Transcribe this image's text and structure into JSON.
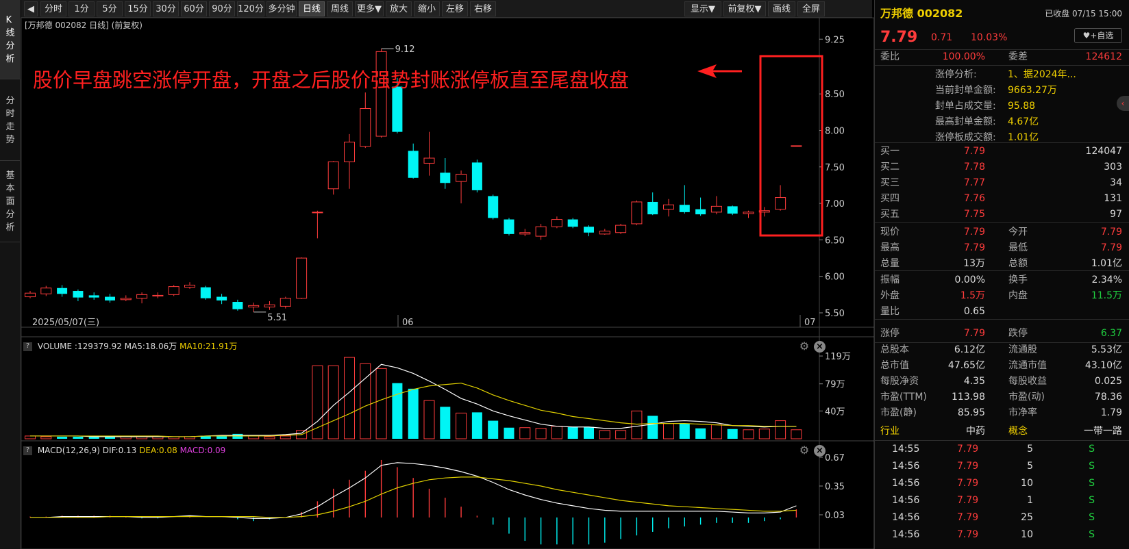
{
  "nav": [
    "K线分析",
    "分时走势",
    "基本面分析"
  ],
  "toolbar": {
    "items": [
      "分时",
      "1分",
      "5分",
      "15分",
      "30分",
      "60分",
      "90分",
      "120分",
      "多分钟",
      "日线",
      "周线",
      "更多▼",
      "放大",
      "缩小",
      "左移",
      "右移"
    ],
    "active": "日线",
    "right": [
      "显示▼",
      "前复权▼",
      "画线",
      "全屏"
    ]
  },
  "chart_title": "[万邦德 002082 日线] (前复权)",
  "annotation": "股价早盘跳空涨停开盘，开盘之后股价强势封账涨停板直至尾盘收盘",
  "kline": {
    "price_axis": [
      "9.25",
      "8.50",
      "8.00",
      "7.50",
      "7.00",
      "6.50",
      "6.00",
      "5.50"
    ],
    "high_label": "9.12",
    "low_label": "5.51",
    "date_labels": [
      "2025/05/07(三)",
      "06",
      "07"
    ],
    "candles": [
      {
        "o": 5.72,
        "c": 5.77,
        "h": 5.8,
        "l": 5.7
      },
      {
        "o": 5.76,
        "c": 5.84,
        "h": 5.87,
        "l": 5.73
      },
      {
        "o": 5.84,
        "c": 5.76,
        "h": 5.88,
        "l": 5.72
      },
      {
        "o": 5.8,
        "c": 5.71,
        "h": 5.82,
        "l": 5.66
      },
      {
        "o": 5.74,
        "c": 5.71,
        "h": 5.78,
        "l": 5.68
      },
      {
        "o": 5.72,
        "c": 5.67,
        "h": 5.76,
        "l": 5.64
      },
      {
        "o": 5.68,
        "c": 5.7,
        "h": 5.74,
        "l": 5.66
      },
      {
        "o": 5.7,
        "c": 5.75,
        "h": 5.78,
        "l": 5.63
      },
      {
        "o": 5.73,
        "c": 5.74,
        "h": 5.78,
        "l": 5.7
      },
      {
        "o": 5.75,
        "c": 5.86,
        "h": 5.88,
        "l": 5.73
      },
      {
        "o": 5.85,
        "c": 5.88,
        "h": 5.92,
        "l": 5.83
      },
      {
        "o": 5.85,
        "c": 5.7,
        "h": 5.87,
        "l": 5.68
      },
      {
        "o": 5.72,
        "c": 5.67,
        "h": 5.76,
        "l": 5.62
      },
      {
        "o": 5.65,
        "c": 5.55,
        "h": 5.68,
        "l": 5.53
      },
      {
        "o": 5.58,
        "c": 5.6,
        "h": 5.64,
        "l": 5.51
      },
      {
        "o": 5.58,
        "c": 5.61,
        "h": 5.66,
        "l": 5.54
      },
      {
        "o": 5.59,
        "c": 5.7,
        "h": 5.72,
        "l": 5.56
      },
      {
        "o": 5.7,
        "c": 6.25,
        "h": 6.26,
        "l": 5.69
      },
      {
        "o": 6.88,
        "c": 6.88,
        "h": 6.9,
        "l": 6.52
      },
      {
        "o": 7.2,
        "c": 7.57,
        "h": 7.58,
        "l": 7.12
      },
      {
        "o": 7.57,
        "c": 7.84,
        "h": 7.95,
        "l": 7.2
      },
      {
        "o": 7.78,
        "c": 8.3,
        "h": 8.52,
        "l": 7.76
      },
      {
        "o": 7.92,
        "c": 9.08,
        "h": 9.12,
        "l": 7.9
      },
      {
        "o": 8.6,
        "c": 7.98,
        "h": 8.72,
        "l": 7.96
      },
      {
        "o": 7.72,
        "c": 7.35,
        "h": 7.82,
        "l": 7.34
      },
      {
        "o": 7.55,
        "c": 7.62,
        "h": 7.98,
        "l": 7.38
      },
      {
        "o": 7.42,
        "c": 7.28,
        "h": 7.62,
        "l": 7.2
      },
      {
        "o": 7.3,
        "c": 7.4,
        "h": 7.45,
        "l": 7.0
      },
      {
        "o": 7.56,
        "c": 7.18,
        "h": 7.6,
        "l": 7.15
      },
      {
        "o": 7.1,
        "c": 6.8,
        "h": 7.12,
        "l": 6.78
      },
      {
        "o": 6.78,
        "c": 6.58,
        "h": 6.8,
        "l": 6.56
      },
      {
        "o": 6.58,
        "c": 6.6,
        "h": 6.65,
        "l": 6.55
      },
      {
        "o": 6.55,
        "c": 6.68,
        "h": 6.72,
        "l": 6.5
      },
      {
        "o": 6.68,
        "c": 6.78,
        "h": 6.82,
        "l": 6.66
      },
      {
        "o": 6.78,
        "c": 6.68,
        "h": 6.8,
        "l": 6.66
      },
      {
        "o": 6.68,
        "c": 6.6,
        "h": 6.7,
        "l": 6.55
      },
      {
        "o": 6.58,
        "c": 6.62,
        "h": 6.65,
        "l": 6.57
      },
      {
        "o": 6.6,
        "c": 6.7,
        "h": 6.72,
        "l": 6.58
      },
      {
        "o": 6.72,
        "c": 7.02,
        "h": 7.04,
        "l": 6.7
      },
      {
        "o": 7.02,
        "c": 6.85,
        "h": 7.15,
        "l": 6.84
      },
      {
        "o": 6.92,
        "c": 6.98,
        "h": 7.06,
        "l": 6.82
      },
      {
        "o": 6.98,
        "c": 6.88,
        "h": 7.25,
        "l": 6.86
      },
      {
        "o": 6.92,
        "c": 6.85,
        "h": 7.08,
        "l": 6.83
      },
      {
        "o": 6.88,
        "c": 6.96,
        "h": 7.1,
        "l": 6.85
      },
      {
        "o": 6.96,
        "c": 6.86,
        "h": 6.97,
        "l": 6.84
      },
      {
        "o": 6.86,
        "c": 6.88,
        "h": 6.9,
        "l": 6.8
      },
      {
        "o": 6.88,
        "c": 6.9,
        "h": 6.95,
        "l": 6.82
      },
      {
        "o": 6.92,
        "c": 7.08,
        "h": 7.25,
        "l": 6.9
      },
      {
        "o": 7.79,
        "c": 7.79,
        "h": 7.79,
        "l": 7.79
      }
    ]
  },
  "volume": {
    "header": {
      "name": "VOLUME",
      "value": ":129379.92",
      "ma5": "MA5:18.06万",
      "ma10": "MA10:21.91万"
    },
    "axis": [
      "119万",
      "79万",
      "40万"
    ],
    "bars": [
      4,
      3,
      3,
      3,
      4,
      3,
      3,
      3,
      3,
      3,
      3,
      4,
      4,
      7,
      4,
      3,
      4,
      12,
      105,
      105,
      117,
      108,
      101,
      80,
      72,
      55,
      46,
      37,
      38,
      26,
      16,
      16,
      15,
      18,
      17,
      17,
      12,
      12,
      40,
      33,
      22,
      22,
      15,
      20,
      14,
      13,
      14,
      26,
      13
    ],
    "ma5": [
      4,
      4,
      4,
      4,
      3,
      3,
      3,
      3,
      3,
      3,
      3,
      4,
      5,
      5,
      5,
      5,
      6,
      8,
      25,
      48,
      67,
      87,
      107,
      102,
      94,
      83,
      71,
      58,
      50,
      40,
      33,
      27,
      21,
      18,
      17,
      17,
      15,
      15,
      18,
      21,
      25,
      26,
      25,
      23,
      19,
      18,
      17,
      18,
      18
    ],
    "ma10": [
      4,
      4,
      4,
      4,
      4,
      4,
      4,
      4,
      4,
      3,
      3,
      4,
      4,
      4,
      4,
      4,
      5,
      6,
      16,
      26,
      36,
      47,
      56,
      64,
      71,
      76,
      78,
      80,
      73,
      63,
      55,
      48,
      41,
      37,
      32,
      29,
      26,
      23,
      21,
      22,
      22,
      22,
      21,
      20,
      19,
      19,
      18,
      18,
      18
    ]
  },
  "macd": {
    "header": {
      "name": "MACD(12,26,9)",
      "dif": "DIF:0.13",
      "dea": "DEA:0.08",
      "macd": "MACD:0.09"
    },
    "axis": [
      "0.67",
      "0.35",
      "0.03"
    ],
    "dif": [
      0.0,
      0.0,
      0.01,
      0.01,
      0.01,
      0.01,
      0.01,
      0.0,
      0.0,
      0.01,
      0.02,
      0.01,
      0.01,
      0.0,
      -0.01,
      -0.01,
      0.0,
      0.04,
      0.12,
      0.23,
      0.33,
      0.44,
      0.58,
      0.61,
      0.6,
      0.58,
      0.55,
      0.51,
      0.46,
      0.39,
      0.31,
      0.25,
      0.2,
      0.16,
      0.13,
      0.1,
      0.08,
      0.07,
      0.07,
      0.07,
      0.07,
      0.07,
      0.07,
      0.07,
      0.06,
      0.05,
      0.05,
      0.06,
      0.13
    ],
    "dea": [
      0.0,
      0.0,
      0.0,
      0.0,
      0.0,
      0.01,
      0.01,
      0.01,
      0.01,
      0.01,
      0.01,
      0.01,
      0.01,
      0.01,
      0.01,
      0.0,
      0.0,
      0.01,
      0.03,
      0.07,
      0.12,
      0.18,
      0.26,
      0.33,
      0.38,
      0.42,
      0.44,
      0.45,
      0.45,
      0.43,
      0.41,
      0.38,
      0.35,
      0.31,
      0.28,
      0.25,
      0.22,
      0.19,
      0.17,
      0.15,
      0.13,
      0.12,
      0.11,
      0.1,
      0.09,
      0.08,
      0.07,
      0.07,
      0.08
    ],
    "hist": [
      0.01,
      0.01,
      0.02,
      0.02,
      0.02,
      0.02,
      0.01,
      -0.01,
      -0.01,
      0.0,
      0.02,
      0.0,
      0.0,
      -0.02,
      -0.04,
      -0.02,
      0.0,
      0.06,
      0.18,
      0.32,
      0.42,
      0.52,
      0.64,
      0.56,
      0.44,
      0.32,
      0.22,
      0.12,
      0.02,
      -0.08,
      -0.18,
      -0.26,
      -0.3,
      -0.3,
      -0.3,
      -0.3,
      -0.28,
      -0.24,
      -0.2,
      -0.16,
      -0.12,
      -0.1,
      -0.08,
      -0.06,
      -0.06,
      -0.06,
      -0.04,
      -0.02,
      0.09
    ]
  },
  "quote": {
    "name": "万邦德 002082",
    "status": "已收盘 07/15 15:00",
    "price": "7.79",
    "change": "0.71",
    "pct": "10.03%",
    "watch_btn": "+自选",
    "wb_label": "委比",
    "wb": "100.00%",
    "wc_label": "委差",
    "wc": "124612",
    "limit": [
      {
        "k": "涨停分析:",
        "v": "1、据2024年..."
      },
      {
        "k": "当前封单金额:",
        "v": "9663.27万"
      },
      {
        "k": "封单占成交量:",
        "v": "95.88"
      },
      {
        "k": "最高封单金额:",
        "v": "4.67亿"
      },
      {
        "k": "涨停板成交额:",
        "v": "1.01亿"
      }
    ],
    "book": [
      {
        "k": "买一",
        "p": "7.79",
        "v": "124047"
      },
      {
        "k": "买二",
        "p": "7.78",
        "v": "303"
      },
      {
        "k": "买三",
        "p": "7.77",
        "v": "34"
      },
      {
        "k": "买四",
        "p": "7.76",
        "v": "131"
      },
      {
        "k": "买五",
        "p": "7.75",
        "v": "97"
      }
    ],
    "stats1": [
      {
        "a": "现价",
        "b": "7.79",
        "bc": "red",
        "c": "今开",
        "d": "7.79",
        "dc": "red"
      },
      {
        "a": "最高",
        "b": "7.79",
        "bc": "red",
        "c": "最低",
        "d": "7.79",
        "dc": "red"
      },
      {
        "a": "总量",
        "b": "13万",
        "bc": "wht",
        "c": "总额",
        "d": "1.01亿",
        "dc": "wht"
      }
    ],
    "stats2": [
      {
        "a": "振幅",
        "b": "0.00%",
        "bc": "wht",
        "c": "换手",
        "d": "2.34%",
        "dc": "wht"
      },
      {
        "a": "外盘",
        "b": "1.5万",
        "bc": "red",
        "c": "内盘",
        "d": "11.5万",
        "dc": "grn"
      },
      {
        "a": "量比",
        "b": "0.65",
        "bc": "wht",
        "c": "",
        "d": "",
        "dc": "wht"
      }
    ],
    "limits": {
      "a": "涨停",
      "b": "7.79",
      "c": "跌停",
      "d": "6.37"
    },
    "fund": [
      {
        "a": "总股本",
        "b": "6.12亿",
        "c": "流通股",
        "d": "5.53亿"
      },
      {
        "a": "总市值",
        "b": "47.65亿",
        "c": "流通市值",
        "d": "43.10亿"
      },
      {
        "a": "每股净资",
        "b": "4.35",
        "c": "每股收益",
        "d": "0.025"
      },
      {
        "a": "市盈(TTM)",
        "b": "113.98",
        "c": "市盈(动)",
        "d": "78.36"
      },
      {
        "a": "市盈(静)",
        "b": "85.95",
        "c": "市净率",
        "d": "1.79"
      }
    ],
    "industry": {
      "a": "行业",
      "b": "中药",
      "c": "概念",
      "d": "一带一路"
    },
    "ticks": [
      {
        "t": "14:55",
        "p": "7.79",
        "v": "5",
        "s": "S"
      },
      {
        "t": "14:56",
        "p": "7.79",
        "v": "5",
        "s": "S"
      },
      {
        "t": "14:56",
        "p": "7.79",
        "v": "10",
        "s": "S"
      },
      {
        "t": "14:56",
        "p": "7.79",
        "v": "1",
        "s": "S"
      },
      {
        "t": "14:56",
        "p": "7.79",
        "v": "25",
        "s": "S"
      },
      {
        "t": "14:56",
        "p": "7.79",
        "v": "10",
        "s": "S"
      }
    ]
  },
  "colors": {
    "up": "#ff3c3c",
    "down": "#00f5f5",
    "ma5": "#ffffff",
    "ma10": "#e0d000",
    "annotation": "#ff2020"
  }
}
